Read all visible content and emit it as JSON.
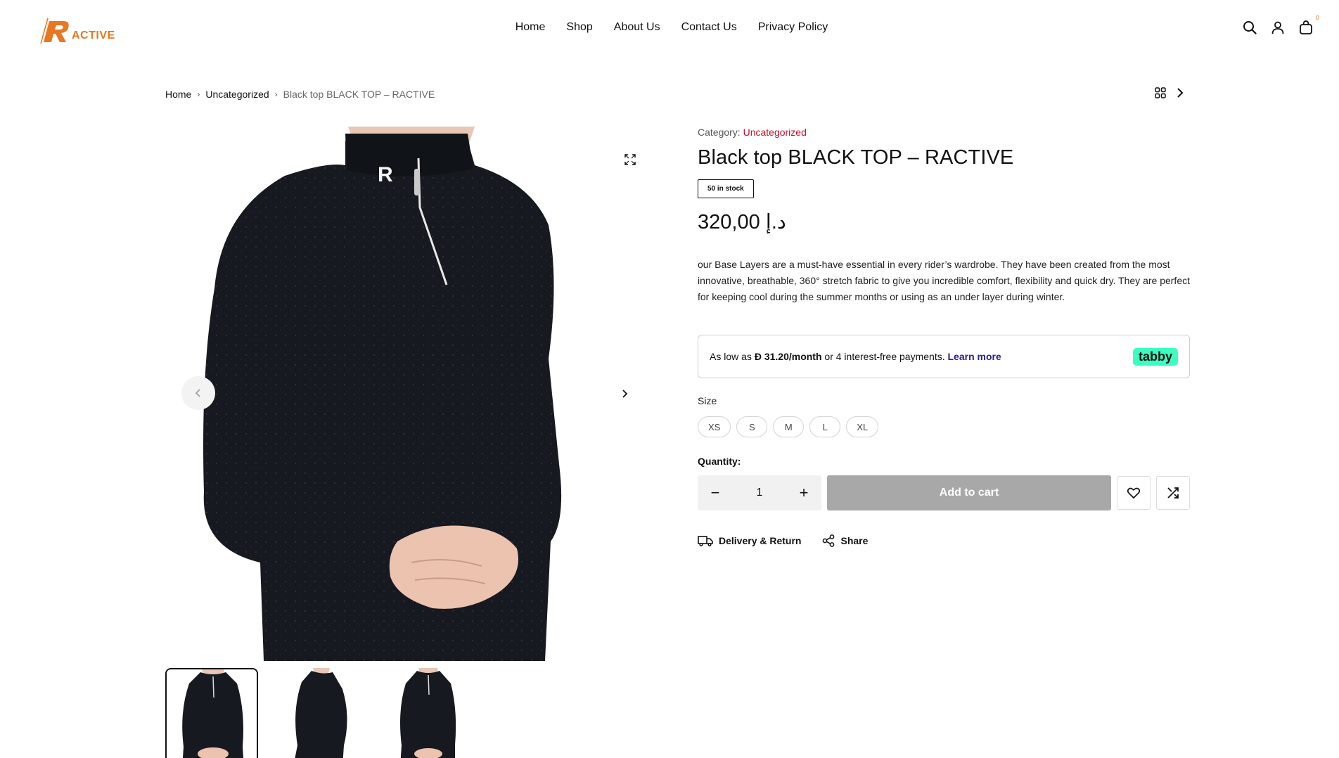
{
  "brand": {
    "name": "ACTIVE",
    "accent": "#e87722"
  },
  "nav": {
    "items": [
      "Home",
      "Shop",
      "About Us",
      "Contact Us",
      "Privacy Policy"
    ]
  },
  "header": {
    "cart_count": "0"
  },
  "breadcrumb": {
    "home": "Home",
    "category": "Uncategorized",
    "current": "Black top BLACK TOP – RACTIVE"
  },
  "product": {
    "category_label": "Category:",
    "category": "Uncategorized",
    "title": "Black top BLACK TOP – RACTIVE",
    "stock": "50 in stock",
    "price": "د.إ 320,00",
    "description": "our Base Layers are a must-have essential in every rider’s wardrobe. They have been created from the most innovative, breathable, 360° stretch fabric to give you incredible comfort, flexibility and quick dry. They are perfect for keeping cool during the summer months or using as an under layer during winter."
  },
  "tabby": {
    "prefix": "As low as",
    "currency": "Ð",
    "amount": "31.20/month",
    "middle": "or 4 interest-free payments.",
    "learn_more": "Learn more",
    "logo": "tabby",
    "logo_color": "#3bffc1"
  },
  "size": {
    "label": "Size",
    "options": [
      "XS",
      "S",
      "M",
      "L",
      "XL"
    ]
  },
  "quantity": {
    "label": "Quantity:",
    "value": "1",
    "minus": "−",
    "plus": "+"
  },
  "cart": {
    "add_label": "Add to cart",
    "button_color": "#a8a8a8"
  },
  "extras": {
    "delivery": "Delivery & Return",
    "share": "Share"
  },
  "icons": [
    "search-icon",
    "user-icon",
    "bag-icon",
    "grid-icon",
    "chevron-right-icon",
    "expand-icon",
    "chevron-left-icon",
    "heart-icon",
    "compare-icon",
    "truck-icon",
    "share-icon"
  ]
}
